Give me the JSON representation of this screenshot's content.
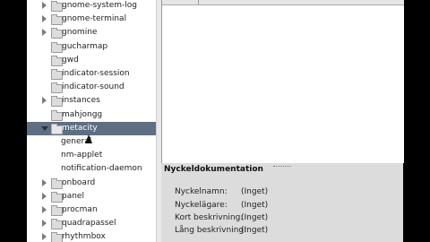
{
  "tree": {
    "items": [
      {
        "label": "gnome-system-log",
        "expander": "collapsed",
        "icon": "folder-icon"
      },
      {
        "label": "gnome-terminal",
        "expander": "collapsed",
        "icon": "folder-icon"
      },
      {
        "label": "gnomine",
        "expander": "collapsed",
        "icon": "folder-icon"
      },
      {
        "label": "gucharmap",
        "expander": "none",
        "icon": "folder-icon"
      },
      {
        "label": "gwd",
        "expander": "none",
        "icon": "folder-icon"
      },
      {
        "label": "indicator-session",
        "expander": "none",
        "icon": "folder-icon"
      },
      {
        "label": "indicator-sound",
        "expander": "none",
        "icon": "folder-icon"
      },
      {
        "label": "instances",
        "expander": "collapsed",
        "icon": "folder-icon"
      },
      {
        "label": "mahjongg",
        "expander": "none",
        "icon": "folder-icon"
      },
      {
        "label": "metacity",
        "expander": "expanded",
        "icon": "folder-icon",
        "selected": true
      },
      {
        "label": "general",
        "expander": "none",
        "icon": "none"
      },
      {
        "label": "nm-applet",
        "expander": "none",
        "icon": "none"
      },
      {
        "label": "notification-daemon",
        "expander": "none",
        "icon": "none"
      },
      {
        "label": "onboard",
        "expander": "collapsed",
        "icon": "folder-icon"
      },
      {
        "label": "panel",
        "expander": "collapsed",
        "icon": "folder-icon"
      },
      {
        "label": "procman",
        "expander": "collapsed",
        "icon": "folder-icon"
      },
      {
        "label": "quadrapassel",
        "expander": "collapsed",
        "icon": "folder-icon"
      },
      {
        "label": "rhythmbox",
        "expander": "collapsed",
        "icon": "folder-icon"
      }
    ]
  },
  "doc": {
    "title": "Nyckeldokumentation",
    "fields": [
      {
        "key": "Nyckelnamn:",
        "value": "(Inget)"
      },
      {
        "key": "Nyckelägare:",
        "value": "(Inget)"
      },
      {
        "key": "Kort beskrivning:",
        "value": "(Inget)"
      },
      {
        "key": "Lång beskrivning:",
        "value": "(Inget)"
      }
    ]
  },
  "colors": {
    "selection": "#5e6f84",
    "pane_background": "#dcdcdc"
  }
}
